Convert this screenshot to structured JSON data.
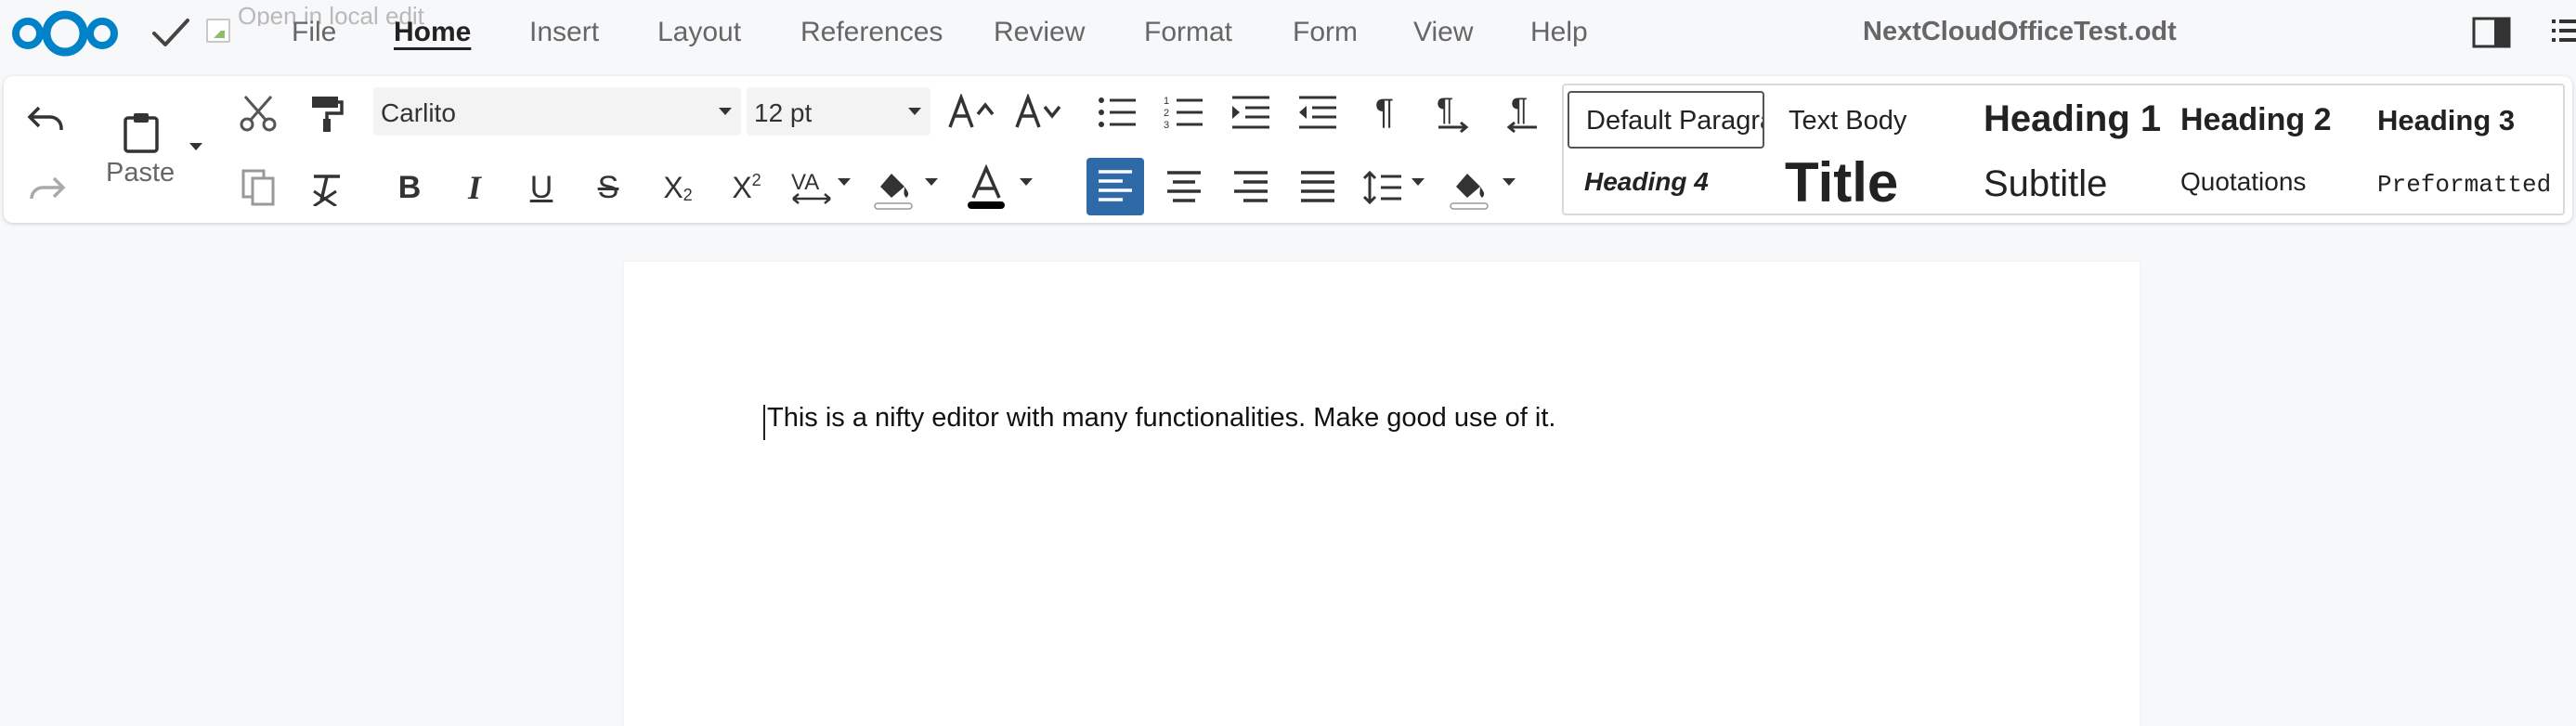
{
  "menubar": {
    "open_local_label": "Open in local edit",
    "items": [
      "File",
      "Home",
      "Insert",
      "Layout",
      "References",
      "Review",
      "Format",
      "Form",
      "View",
      "Help"
    ],
    "active": "Home",
    "doc_title": "NextCloudOfficeTest.odt"
  },
  "ribbon": {
    "paste_label": "Paste",
    "font_name": "Carlito",
    "font_size": "12 pt",
    "active_alignment": "left"
  },
  "styles": {
    "items": [
      "Default Paragraph Style",
      "Text Body",
      "Heading 1",
      "Heading 2",
      "Heading 3",
      "Heading 4",
      "Title",
      "Subtitle",
      "Quotations",
      "Preformatted Text"
    ],
    "selected": "Default Paragraph Style"
  },
  "document": {
    "paragraph": "This is a nifty editor with many functionalities. Make good use of it."
  },
  "colors": {
    "brand_blue": "#0082c9",
    "active_button": "#2f6aa8",
    "background": "#f7f8fa"
  }
}
